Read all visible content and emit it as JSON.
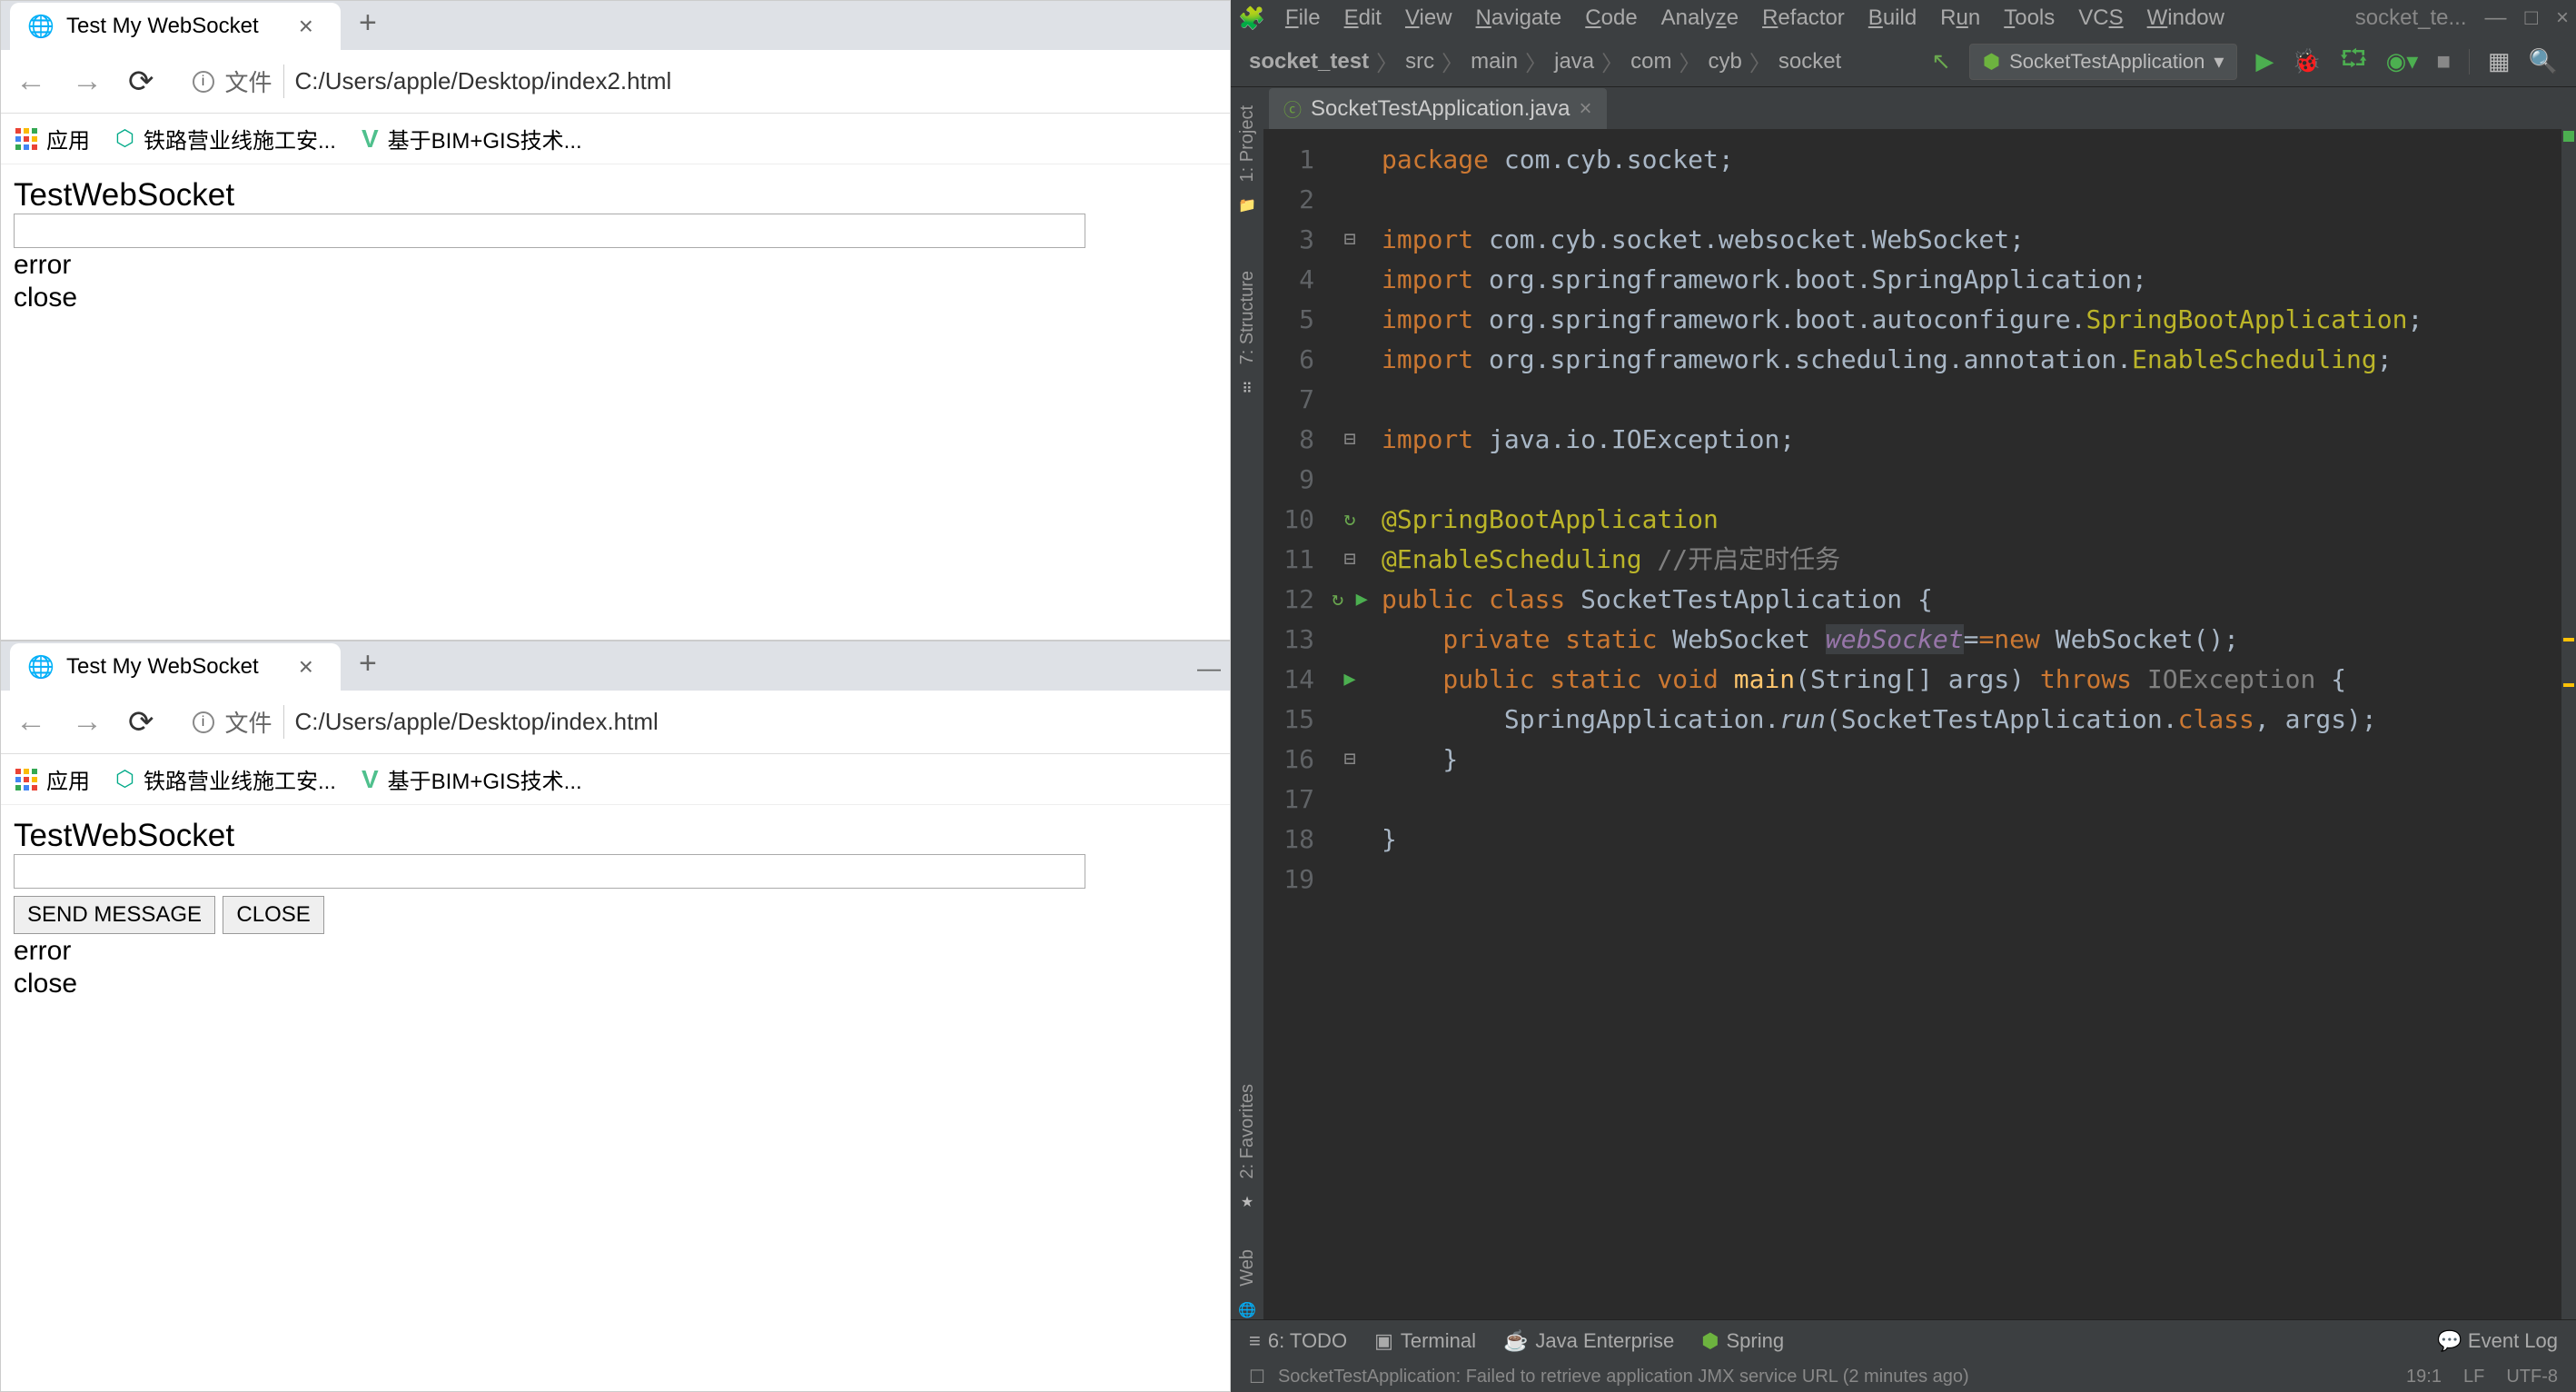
{
  "browser1": {
    "tab_title": "Test My WebSocket",
    "addr_label": "文件",
    "addr_url": "C:/Users/apple/Desktop/index2.html",
    "bookmarks": {
      "apps": "应用",
      "b1": "铁路营业线施工安...",
      "b2": "基于BIM+GIS技术..."
    },
    "page": {
      "heading": "TestWebSocket",
      "line1": "error",
      "line2": "close"
    }
  },
  "browser2": {
    "tab_title": "Test My WebSocket",
    "addr_label": "文件",
    "addr_url": "C:/Users/apple/Desktop/index.html",
    "bookmarks": {
      "apps": "应用",
      "b1": "铁路营业线施工安...",
      "b2": "基于BIM+GIS技术..."
    },
    "page": {
      "heading": "TestWebSocket",
      "btn_send": "SEND MESSAGE",
      "btn_close": "CLOSE",
      "line1": "error",
      "line2": "close"
    }
  },
  "ide": {
    "menus": [
      "File",
      "Edit",
      "View",
      "Navigate",
      "Code",
      "Analyze",
      "Refactor",
      "Build",
      "Run",
      "Tools",
      "VCS",
      "Window"
    ],
    "win_title": "socket_te...",
    "breadcrumb": [
      "socket_test",
      "src",
      "main",
      "java",
      "com",
      "cyb",
      "socket"
    ],
    "run_config": "SocketTestApplication",
    "tool_windows": {
      "project": "1: Project",
      "structure": "7: Structure",
      "favorites": "2: Favorites",
      "web": "Web"
    },
    "tab": {
      "name": "SocketTestApplication.java"
    },
    "line_numbers": [
      "1",
      "2",
      "3",
      "4",
      "5",
      "6",
      "7",
      "8",
      "9",
      "10",
      "11",
      "12",
      "13",
      "14",
      "15",
      "16",
      "17",
      "18",
      "19"
    ],
    "code": {
      "l1_kw": "package ",
      "l1_rest": "com.cyb.socket;",
      "l3_kw": "import ",
      "l3_rest": "com.cyb.socket.websocket.WebSocket;",
      "l4_kw": "import ",
      "l4_rest": "org.springframework.boot.SpringApplication;",
      "l5_kw": "import ",
      "l5_rest": "org.springframework.boot.autoconfigure.",
      "l5_cls": "SpringBootApplication",
      "l5_semi": ";",
      "l6_kw": "import ",
      "l6_rest": "org.springframework.scheduling.annotation.",
      "l6_cls": "EnableScheduling",
      "l6_semi": ";",
      "l8_kw": "import ",
      "l8_rest": "java.io.IOException;",
      "l10": "@SpringBootApplication",
      "l11_ann": "@EnableScheduling ",
      "l11_com": "//开启定时任务",
      "l12_pub": "public class ",
      "l12_name": "SocketTestApplication ",
      "l12_brace": "{",
      "l13_vis": "    private static ",
      "l13_type": "WebSocket ",
      "l13_var": "webSocket",
      "l13_rest": "=new ",
      "l13_ctor": "WebSocket();",
      "l14_vis": "    public static void ",
      "l14_main": "main",
      "l14_args": "(String[] args) ",
      "l14_throws": "throws ",
      "l14_exc": "IOException ",
      "l14_brace": "{",
      "l15_pre": "        SpringApplication.",
      "l15_run": "run",
      "l15_args": "(SocketTestApplication.",
      "l15_class": "class",
      "l15_rest": ", args);",
      "l16": "    }",
      "l18": "}"
    },
    "status": {
      "todo": "6: TODO",
      "terminal": "Terminal",
      "javaee": "Java Enterprise",
      "spring": "Spring",
      "msg": "SocketTestApplication: Failed to retrieve application JMX service URL (2 minutes ago)",
      "pos": "19:1",
      "le": "LF",
      "enc": "UTF-8",
      "event_log": "Event Log"
    }
  }
}
